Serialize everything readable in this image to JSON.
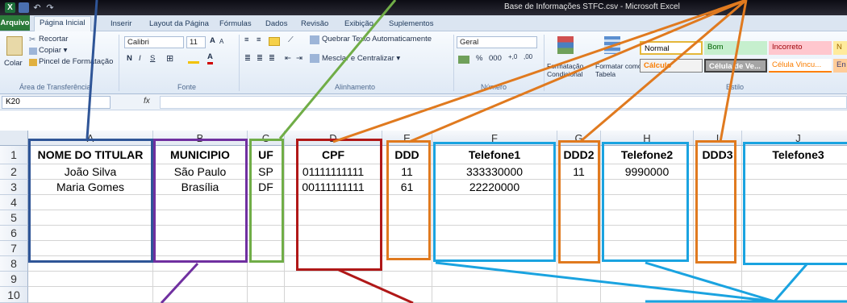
{
  "window": {
    "title": "Base de Informações STFC.csv - Microsoft Excel",
    "app_icon": "X"
  },
  "tabs": [
    {
      "label": "Arquivo"
    },
    {
      "label": "Página Inicial"
    },
    {
      "label": "Inserir"
    },
    {
      "label": "Layout da Página"
    },
    {
      "label": "Fórmulas"
    },
    {
      "label": "Dados"
    },
    {
      "label": "Revisão"
    },
    {
      "label": "Exibição"
    },
    {
      "label": "Suplementos"
    }
  ],
  "ribbon": {
    "clipboard": {
      "paste": "Colar",
      "cut": "Recortar",
      "copy": "Copiar ▾",
      "format_painter": "Pincel de Formatação",
      "group": "Área de Transferência"
    },
    "font": {
      "name": "Calibri",
      "size": "11",
      "bold": "N",
      "italic": "I",
      "underline": "S",
      "group": "Fonte"
    },
    "alignment": {
      "wrap": "Quebrar Texto Automaticamente",
      "merge": "Mesclar e Centralizar ▾",
      "group": "Alinhamento"
    },
    "number": {
      "format": "Geral",
      "percent": "%",
      "thousands": "000",
      "group": "Número"
    },
    "styles": {
      "conditional": "Formatação Condicional",
      "as_table": "Formatar como Tabela",
      "normal": "Normal",
      "bom": "Bom",
      "incorreto": "Incorreto",
      "neutral_cut": "N",
      "calculo": "Cálculo",
      "celula_ve": "Célula de Ve...",
      "celula_vinc": "Célula Vincu...",
      "en_cut": "En",
      "group": "Estilo"
    }
  },
  "formula_bar": {
    "name_box": "K20",
    "fx": "fx",
    "value": ""
  },
  "sheet": {
    "columns": [
      "A",
      "B",
      "C",
      "D",
      "E",
      "F",
      "G",
      "H",
      "I",
      "J"
    ],
    "rows": [
      "1",
      "2",
      "3",
      "4",
      "5",
      "6",
      "7",
      "8",
      "9",
      "10"
    ],
    "headers": [
      "NOME DO TITULAR",
      "MUNICIPIO",
      "UF",
      "CPF",
      "DDD",
      "Telefone1",
      "DDD2",
      "Telefone2",
      "DDD3",
      "Telefone3"
    ],
    "data": [
      [
        "João Silva",
        "São Paulo",
        "SP",
        "01111111111",
        "11",
        "333330000",
        "11",
        "9990000",
        "",
        ""
      ],
      [
        "Maria Gomes",
        "Brasília",
        "DF",
        "00111111111",
        "61",
        "22220000",
        "",
        "",
        "",
        ""
      ]
    ]
  },
  "colors": {
    "blue_dark": "#2f5597",
    "purple": "#7030a0",
    "green": "#70ad47",
    "red": "#b01818",
    "orange": "#e07a1f",
    "cyan": "#1aa3e0"
  }
}
